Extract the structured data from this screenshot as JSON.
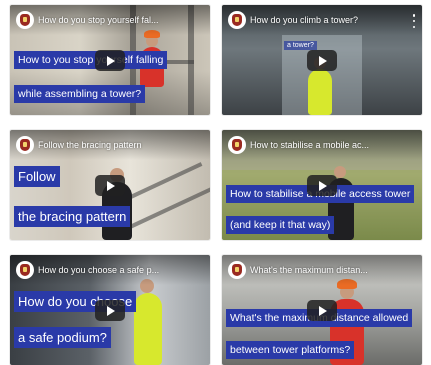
{
  "videos": [
    {
      "title": "How do you stop yourself fal...",
      "captions": [
        "How to you stop yourself falling",
        "while assembling a tower?"
      ],
      "show_menu": false
    },
    {
      "title": "How do you climb a tower?",
      "captions": [
        "a tower?"
      ],
      "show_menu": true
    },
    {
      "title": "Follow the bracing pattern",
      "captions": [
        "Follow",
        "the bracing pattern"
      ],
      "show_menu": false
    },
    {
      "title": "How to stabilise a mobile ac...",
      "captions": [
        "How to stabilise a mobile access tower",
        "(and keep it that way)"
      ],
      "show_menu": false
    },
    {
      "title": "How do you choose a safe p...",
      "captions": [
        "How do you choose",
        "a safe podium?"
      ],
      "show_menu": false
    },
    {
      "title": "What's the maximum distan...",
      "captions": [
        "What's the maximum distance allowed",
        "between tower platforms?"
      ],
      "show_menu": false
    }
  ],
  "colors": {
    "caption_bg": "#2a3aa8",
    "play_bg": "#212121"
  }
}
